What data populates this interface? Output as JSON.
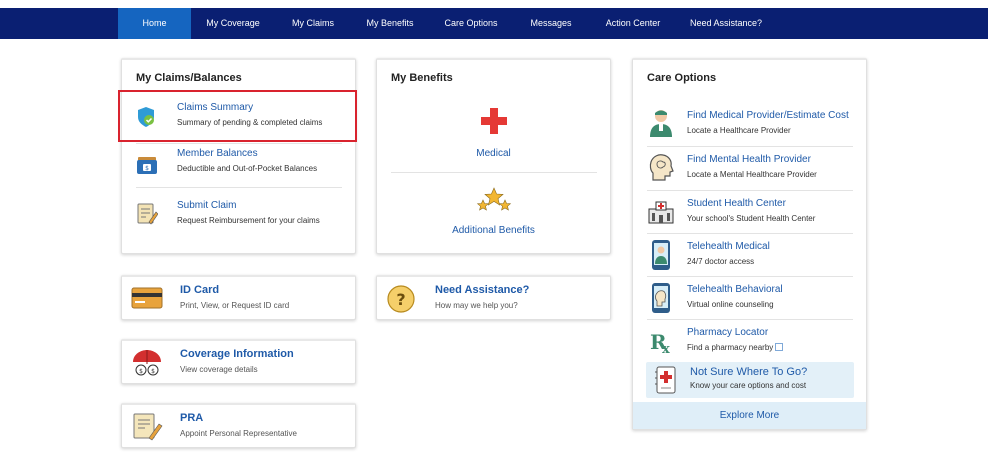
{
  "nav": {
    "items": [
      {
        "label": "Home"
      },
      {
        "label": "My Coverage"
      },
      {
        "label": "My Claims"
      },
      {
        "label": "My Benefits"
      },
      {
        "label": "Care Options"
      },
      {
        "label": "Messages"
      },
      {
        "label": "Action Center"
      },
      {
        "label": "Need Assistance?"
      }
    ]
  },
  "claims": {
    "title": "My Claims/Balances",
    "rows": [
      {
        "title": "Claims Summary",
        "sub": "Summary of pending & completed claims"
      },
      {
        "title": "Member Balances",
        "sub": "Deductible and Out-of-Pocket Balances"
      },
      {
        "title": "Submit Claim",
        "sub": "Request Reimbursement for your claims"
      }
    ]
  },
  "benefits": {
    "title": "My Benefits",
    "medical": "Medical",
    "additional": "Additional Benefits"
  },
  "tiles": {
    "idcard": {
      "title": "ID Card",
      "sub": "Print, View, or Request ID card"
    },
    "coverage": {
      "title": "Coverage Information",
      "sub": "View coverage details"
    },
    "pra": {
      "title": "PRA",
      "sub": "Appoint Personal Representative"
    },
    "assist": {
      "title": "Need Assistance?",
      "sub": "How may we help you?"
    }
  },
  "care": {
    "title": "Care Options",
    "rows": [
      {
        "title": "Find Medical Provider/Estimate Cost",
        "sub": "Locate a Healthcare Provider"
      },
      {
        "title": "Find Mental Health Provider",
        "sub": "Locate a Mental Healthcare Provider"
      },
      {
        "title": "Student Health Center",
        "sub": "Your school's Student Health Center"
      },
      {
        "title": "Telehealth Medical",
        "sub": "24/7 doctor access"
      },
      {
        "title": "Telehealth Behavioral",
        "sub": "Virtual online counseling"
      },
      {
        "title": "Pharmacy Locator",
        "sub": "Find a pharmacy nearby"
      }
    ],
    "notsure_title": "Not Sure Where To Go?",
    "notsure_sub": "Know your care options and cost",
    "explore": "Explore More"
  },
  "colors": {
    "nav_bg": "#0a1f72",
    "nav_active": "#1565c0",
    "link": "#1f5aa8",
    "highlight": "#d9232e",
    "medical_cross": "#e53935"
  }
}
